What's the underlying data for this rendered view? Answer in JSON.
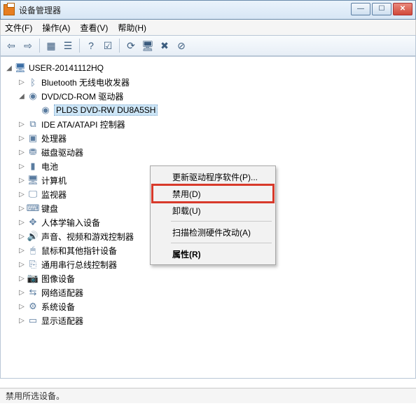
{
  "window": {
    "title": "设备管理器"
  },
  "menu": {
    "file": "文件(F)",
    "action": "操作(A)",
    "view": "查看(V)",
    "help": "帮助(H)"
  },
  "tree": {
    "root": "USER-20141112HQ",
    "items": [
      "Bluetooth 无线电收发器",
      "DVD/CD-ROM 驱动器",
      "IDE ATA/ATAPI 控制器",
      "处理器",
      "磁盘驱动器",
      "电池",
      "计算机",
      "监视器",
      "键盘",
      "人体学输入设备",
      "声音、视频和游戏控制器",
      "鼠标和其他指针设备",
      "通用串行总线控制器",
      "图像设备",
      "网络适配器",
      "系统设备",
      "显示适配器"
    ],
    "dvd_child": "PLDS DVD-RW DU8A5SH"
  },
  "context_menu": {
    "update": "更新驱动程序软件(P)...",
    "disable": "禁用(D)",
    "uninstall": "卸载(U)",
    "scan": "扫描检测硬件改动(A)",
    "properties": "属性(R)"
  },
  "status": "禁用所选设备。",
  "icons": {
    "bluetooth": "ᛒ",
    "disc": "◉",
    "controller": "⧉",
    "cpu": "▣",
    "disk": "⛃",
    "battery": "▮",
    "computer": "🖥",
    "monitor": "🖵",
    "keyboard": "⌨",
    "hid": "✥",
    "sound": "🔊",
    "mouse": "🖱",
    "usb": "⎘",
    "image": "📷",
    "network": "⇆",
    "system": "⚙",
    "display": "▭"
  }
}
